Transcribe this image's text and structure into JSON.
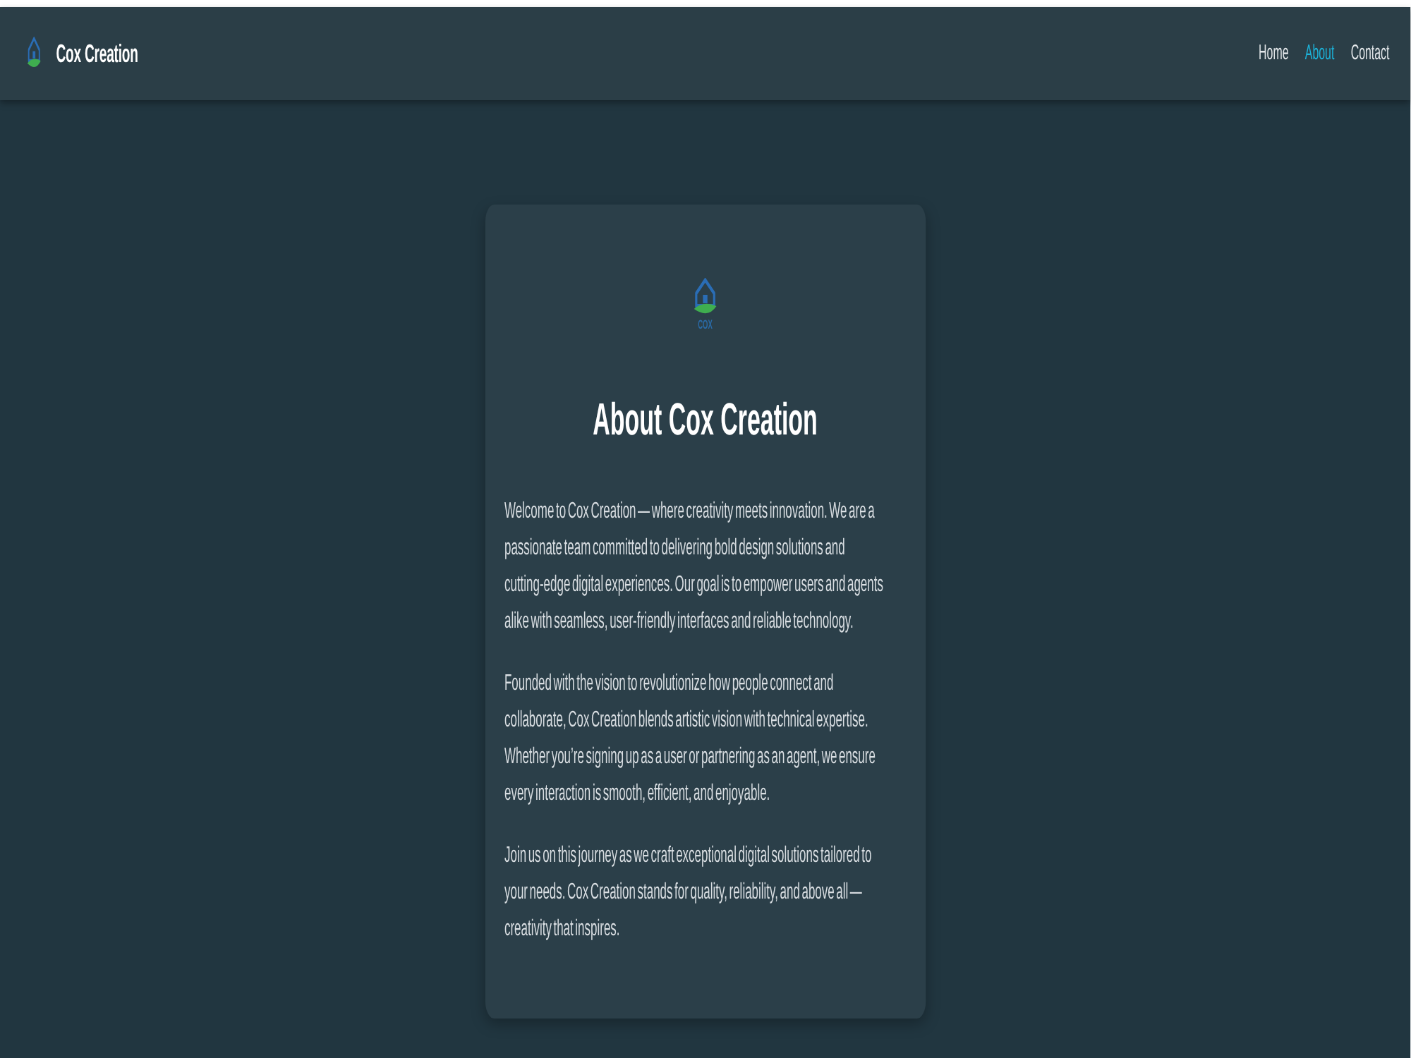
{
  "navbar": {
    "brand": {
      "name": "Cox Creation"
    },
    "links": [
      {
        "label": "Home",
        "selected": false
      },
      {
        "label": "About",
        "selected": true
      },
      {
        "label": "Contact",
        "selected": false
      }
    ]
  },
  "about_card": {
    "logo": {
      "wordmark": "COX"
    },
    "title": "About Cox Creation",
    "paragraphs": [
      "Welcome to Cox Creation — where creativity meets innovation. We are a passionate team committed to delivering bold design solutions and cutting-edge digital experiences. Our goal is to empower users and agents alike with seamless, user-friendly interfaces and reliable technology.",
      "Founded with the vision to revolutionize how people connect and collaborate, Cox Creation blends artistic vision with technical expertise. Whether you’re signing up as a user or partnering as an agent, we ensure every interaction is smooth, efficient, and enjoyable.",
      "Join us on this journey as we craft exceptional digital solutions tailored to your needs. Cox Creation stands for quality, reliability, and above all — creativity that inspires."
    ]
  }
}
